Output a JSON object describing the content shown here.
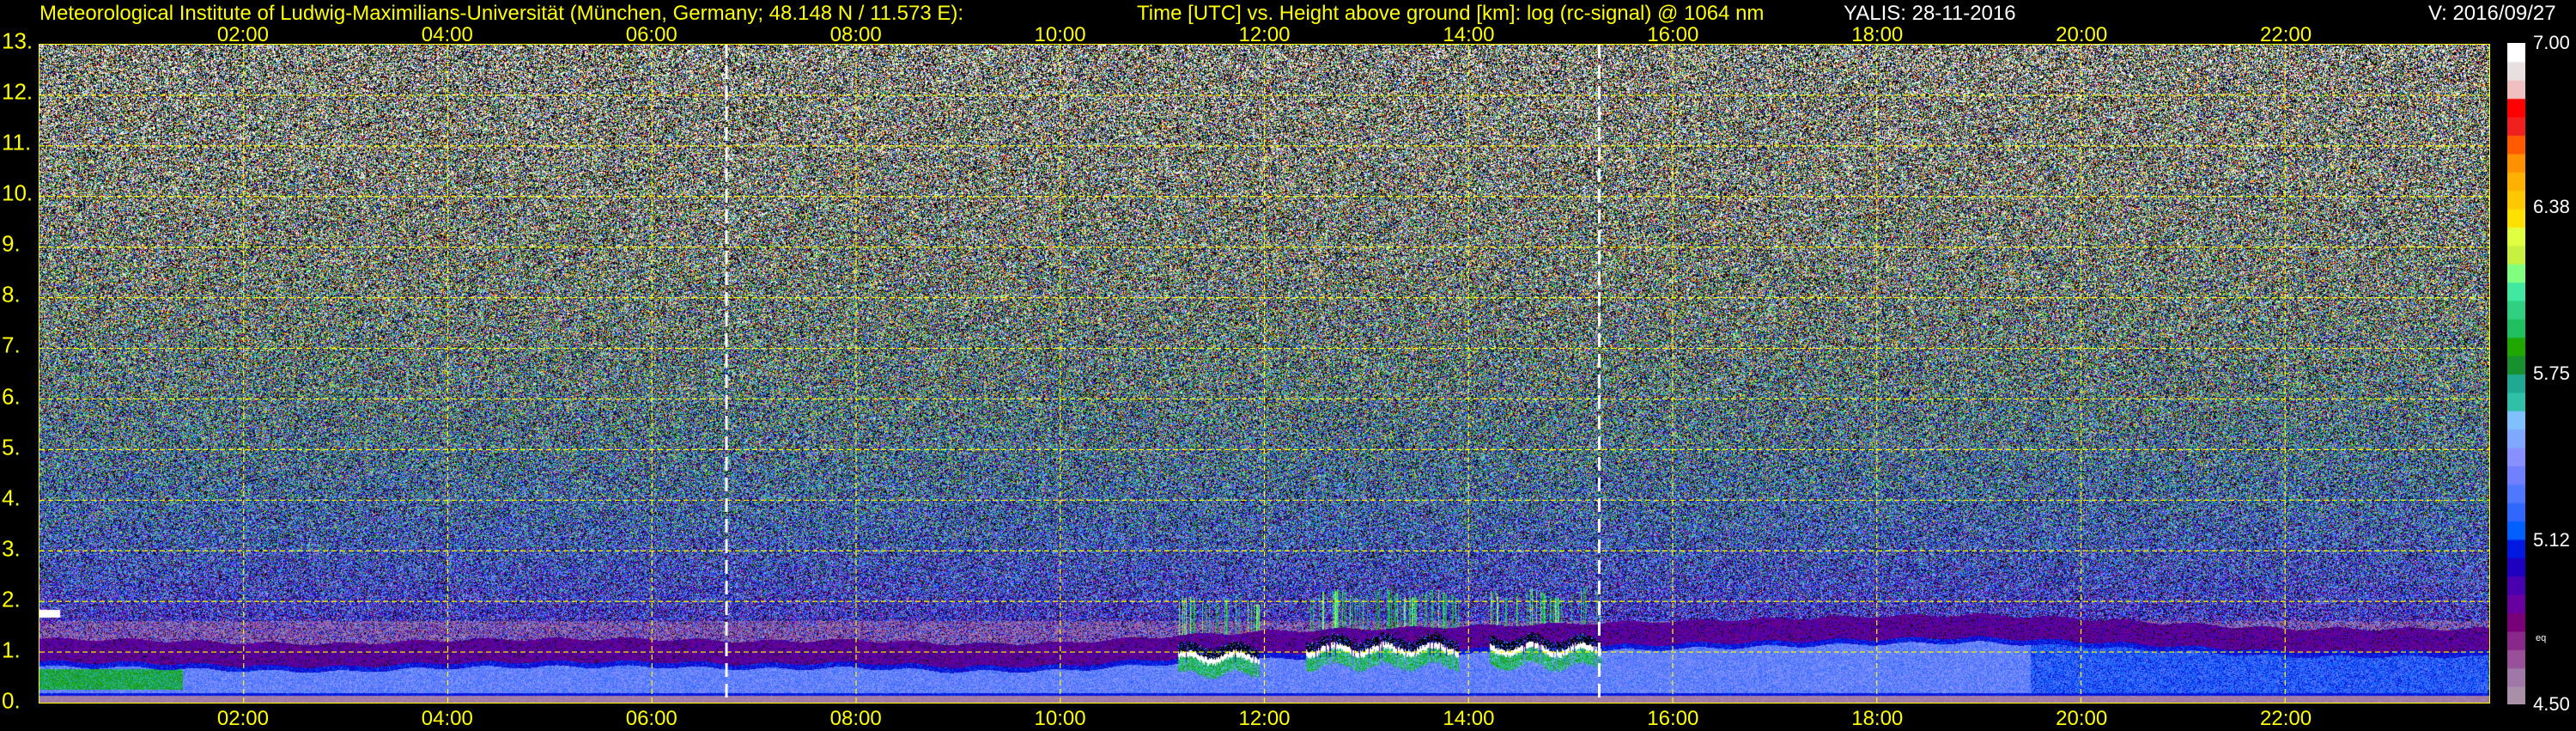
{
  "header": {
    "institute": "Meteorological Institute of Ludwig-Maximilians-Universität (München, Germany; 48.148 N / 11.573 E):",
    "description": "Time [UTC] vs. Height above ground [km]: log (rc-signal) @ 1064 nm",
    "instrument_date": "YALIS: 28-11-2016",
    "version": "V: 2016/09/27"
  },
  "chart_data": {
    "type": "heatmap",
    "title": "Time [UTC] vs. Height above ground [km]: log (rc-signal) @ 1064 nm",
    "xlabel": "Time [UTC]",
    "ylabel": "Height above ground [km]",
    "xlim_hours": [
      0,
      24
    ],
    "ylim_km": [
      0,
      13
    ],
    "x_tick_labels": [
      "02:00",
      "04:00",
      "06:00",
      "08:00",
      "10:00",
      "12:00",
      "14:00",
      "16:00",
      "18:00",
      "20:00",
      "22:00"
    ],
    "x_tick_hours": [
      2,
      4,
      6,
      8,
      10,
      12,
      14,
      16,
      18,
      20,
      22
    ],
    "y_tick_labels": [
      "0.",
      "1.",
      "2.",
      "3.",
      "4.",
      "5.",
      "6.",
      "7.",
      "8.",
      "9.",
      "10.",
      "11.",
      "12.",
      "13."
    ],
    "y_tick_values": [
      0,
      1,
      2,
      3,
      4,
      5,
      6,
      7,
      8,
      9,
      10,
      11,
      12,
      13
    ],
    "grid": true,
    "marker_lines_hours": [
      6.73,
      15.28
    ],
    "colorbar": {
      "range": [
        4.5,
        7.0
      ],
      "tick_labels": [
        "7.00",
        "6.38",
        "5.75",
        "5.12",
        "4.50"
      ],
      "tick_values": [
        7.0,
        6.38,
        5.75,
        5.12,
        4.5
      ],
      "note": "eq",
      "colors_low_to_high": [
        "#a890a8",
        "#a078a8",
        "#985098",
        "#882888",
        "#780078",
        "#6800a0",
        "#4800b0",
        "#2000c0",
        "#0018e0",
        "#0060ff",
        "#3068ff",
        "#5078ff",
        "#7080ff",
        "#8890ff",
        "#80a8ff",
        "#80c0ff",
        "#30c0a8",
        "#20a890",
        "#189030",
        "#20a800",
        "#20c060",
        "#30d080",
        "#40e8a0",
        "#80ff80",
        "#c8f040",
        "#e0ff40",
        "#ffe000",
        "#ffc800",
        "#ffb000",
        "#ff9000",
        "#ff5a00",
        "#f02020",
        "#ff0000",
        "#f0c0c0",
        "#e8e0e0",
        "#ffffff"
      ]
    },
    "aerosol_layer_top_km_hourly": [
      0.8,
      0.78,
      0.72,
      0.7,
      0.78,
      0.8,
      0.8,
      0.75,
      0.78,
      0.7,
      0.72,
      0.85,
      0.95,
      1.0,
      1.05,
      1.1,
      1.15,
      1.2,
      1.25,
      1.28,
      1.2,
      1.1,
      1.0,
      1.0,
      1.0
    ],
    "cloud_segments": [
      {
        "start_hour": 11.15,
        "end_hour": 11.95,
        "base_km": 0.9
      },
      {
        "start_hour": 12.4,
        "end_hour": 13.9,
        "base_km": 1.05
      },
      {
        "start_hour": 14.2,
        "end_hour": 15.3,
        "base_km": 1.05
      }
    ],
    "early_cloud": {
      "start_hour": 0.0,
      "end_hour": 0.2,
      "base_km": 1.75
    }
  }
}
